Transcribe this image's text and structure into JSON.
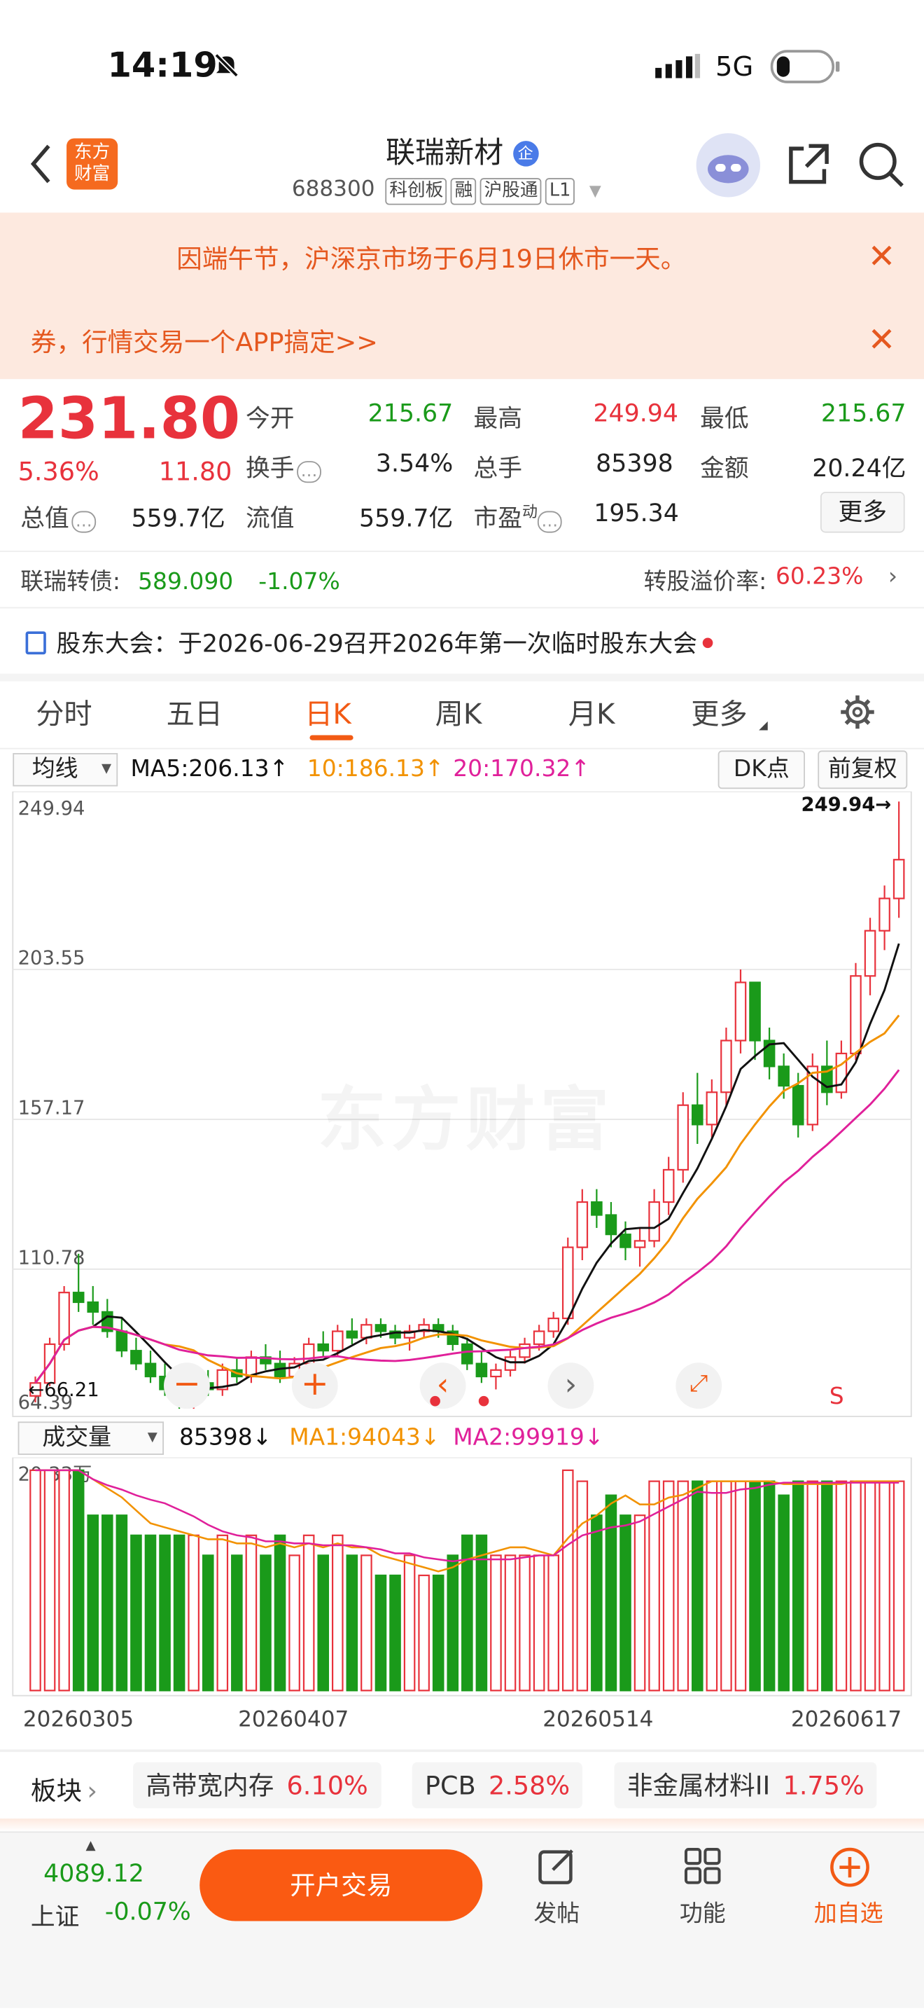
{
  "status": {
    "time": "14:19",
    "network": "5G"
  },
  "header": {
    "back_icon": "back-arrow-icon",
    "app_logo": "东方\n财富",
    "stock_name": "联瑞新材",
    "enterprise_badge": "企",
    "stock_code": "688300",
    "tags": [
      "科创板",
      "融",
      "沪股通",
      "L1"
    ]
  },
  "banner": {
    "notice1": "因端午节，沪深京市场于6月19日休市一天。",
    "notice2": "券，行情交易一个APP搞定>>"
  },
  "quote": {
    "price": "231.80",
    "change_pct": "5.36%",
    "change_amt": "11.80",
    "open_label": "今开",
    "open": "215.67",
    "high_label": "最高",
    "high": "249.94",
    "low_label": "最低",
    "low": "215.67",
    "turnover_label": "换手",
    "turnover": "3.54%",
    "volume_label": "总手",
    "volume": "85398",
    "amount_label": "金额",
    "amount": "20.24亿",
    "mktcap_label": "总值",
    "mktcap": "559.7亿",
    "float_label": "流值",
    "float": "559.7亿",
    "pe_label": "市盈",
    "pe_sup": "动",
    "pe": "195.34",
    "more": "更多"
  },
  "bond": {
    "label": "联瑞转债:",
    "price": "589.090",
    "pct": "-1.07%",
    "premium_label": "转股溢价率:",
    "premium": "60.23%"
  },
  "meeting": {
    "text": "股东大会：于2026-06-29召开2026年第一次临时股东大会"
  },
  "tabs": [
    "分时",
    "五日",
    "日K",
    "周K",
    "月K",
    "更多"
  ],
  "ma_legend": {
    "select": "均线",
    "ma5": "MA5:206.13↑",
    "ma10": "10:186.13↑",
    "ma20": "20:170.32↑",
    "dk": "DK点",
    "fq": "前复权"
  },
  "price_axis": [
    "249.94",
    "203.55",
    "157.17",
    "110.78",
    "64.39"
  ],
  "high_marker": "249.94→",
  "low_marker": "66.21",
  "watermark": "东方财富",
  "vol_legend": {
    "select": "成交量",
    "vol": "85398↓",
    "ma1": "MA1:94043↓",
    "ma2": "MA2:99919↓",
    "max": "20.33万"
  },
  "dates": [
    "20260305",
    "20260407",
    "20260514",
    "20260617"
  ],
  "sectors": {
    "label": "板块",
    "items": [
      {
        "name": "高带宽内存",
        "pct": "6.10%"
      },
      {
        "name": "PCB",
        "pct": "2.58%"
      },
      {
        "name": "非金属材料II",
        "pct": "1.75%"
      }
    ]
  },
  "bottom": {
    "index_value": "4089.12",
    "index_name": "上证",
    "index_pct": "-0.07%",
    "trade": "开户交易",
    "post": "发帖",
    "func": "功能",
    "watch": "加自选"
  },
  "colors": {
    "up": "#e8323c",
    "down": "#1a9a1a",
    "ma5": "#111111",
    "ma10": "#f29200",
    "ma20": "#e0209a",
    "accent": "#fa5a12"
  },
  "chart_data": {
    "type": "candlestick",
    "candles": [
      [
        66,
        72,
        64,
        70
      ],
      [
        70,
        84,
        69,
        82
      ],
      [
        82,
        100,
        80,
        98
      ],
      [
        98,
        110,
        92,
        95
      ],
      [
        95,
        100,
        88,
        92
      ],
      [
        92,
        96,
        84,
        86
      ],
      [
        86,
        90,
        78,
        80
      ],
      [
        80,
        84,
        74,
        76
      ],
      [
        76,
        80,
        70,
        72
      ],
      [
        72,
        76,
        66,
        68
      ],
      [
        68,
        72,
        62,
        64
      ],
      [
        64,
        72,
        62,
        70
      ],
      [
        70,
        74,
        66,
        68
      ],
      [
        68,
        76,
        66,
        74
      ],
      [
        74,
        78,
        70,
        72
      ],
      [
        72,
        80,
        70,
        78
      ],
      [
        78,
        82,
        74,
        76
      ],
      [
        76,
        80,
        70,
        72
      ],
      [
        72,
        78,
        70,
        76
      ],
      [
        76,
        84,
        74,
        82
      ],
      [
        82,
        86,
        78,
        80
      ],
      [
        80,
        88,
        78,
        86
      ],
      [
        86,
        90,
        82,
        84
      ],
      [
        84,
        90,
        82,
        88
      ],
      [
        88,
        90,
        84,
        86
      ],
      [
        86,
        88,
        82,
        84
      ],
      [
        84,
        88,
        80,
        86
      ],
      [
        86,
        90,
        84,
        88
      ],
      [
        88,
        90,
        84,
        86
      ],
      [
        86,
        88,
        80,
        82
      ],
      [
        82,
        84,
        74,
        76
      ],
      [
        76,
        80,
        70,
        72
      ],
      [
        72,
        76,
        68,
        74
      ],
      [
        74,
        80,
        72,
        78
      ],
      [
        78,
        84,
        76,
        82
      ],
      [
        82,
        88,
        80,
        86
      ],
      [
        86,
        92,
        84,
        90
      ],
      [
        90,
        115,
        88,
        112
      ],
      [
        112,
        130,
        108,
        126
      ],
      [
        126,
        130,
        118,
        122
      ],
      [
        122,
        126,
        112,
        116
      ],
      [
        116,
        120,
        108,
        112
      ],
      [
        112,
        118,
        106,
        114
      ],
      [
        114,
        130,
        112,
        126
      ],
      [
        126,
        140,
        122,
        136
      ],
      [
        136,
        160,
        132,
        156
      ],
      [
        156,
        166,
        144,
        150
      ],
      [
        150,
        164,
        146,
        160
      ],
      [
        160,
        180,
        156,
        176
      ],
      [
        176,
        198,
        172,
        194
      ],
      [
        194,
        188,
        170,
        176
      ],
      [
        176,
        180,
        164,
        168
      ],
      [
        168,
        172,
        158,
        162
      ],
      [
        162,
        166,
        146,
        150
      ],
      [
        150,
        172,
        148,
        168
      ],
      [
        168,
        176,
        156,
        160
      ],
      [
        160,
        176,
        158,
        172
      ],
      [
        172,
        200,
        170,
        196
      ],
      [
        196,
        214,
        190,
        210
      ],
      [
        210,
        224,
        204,
        220
      ],
      [
        220,
        250,
        214,
        232
      ]
    ],
    "volume_max": "20.33万",
    "ylim": [
      64.39,
      249.94
    ]
  }
}
